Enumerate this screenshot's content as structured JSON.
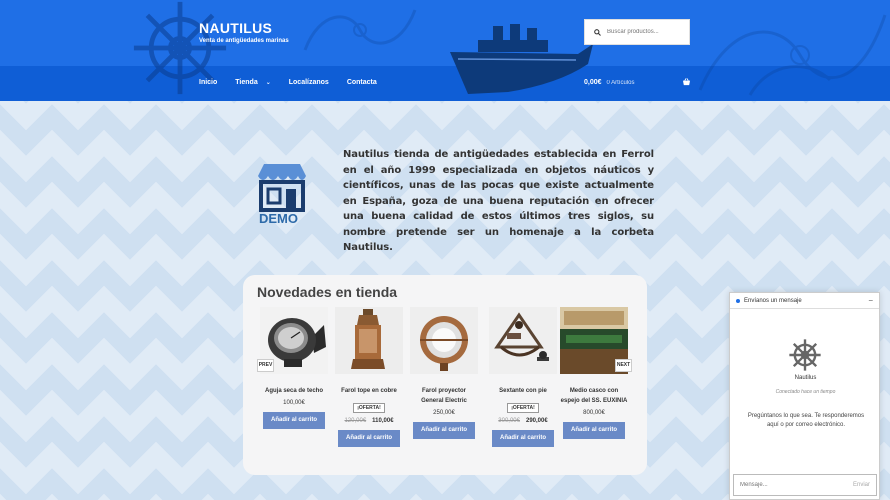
{
  "header": {
    "site_title": "NAUTILUS",
    "site_description": "Venta de antigüedades marinas",
    "search_placeholder": "Buscar productos...",
    "nav": [
      {
        "label": "Inicio"
      },
      {
        "label": "Tienda"
      },
      {
        "label": "Localízanos"
      },
      {
        "label": "Contacta"
      }
    ],
    "cart_total": "0,00€",
    "cart_count": "0 Artículos"
  },
  "intro": {
    "logo_text": "DEMO",
    "text": "Nautilus tienda de antigüedades establecida en Ferrol en el año 1999 especializada en objetos náuticos y científicos, unas de las pocas que existe actualmente en España, goza de una buena reputación en ofrecer una buena calidad de estos últimos tres siglos, su nombre pretende ser un homenaje a la corbeta Nautilus."
  },
  "products_section": {
    "title": "Novedades en tienda",
    "prev_label": "PREV",
    "next_label": "NEXT",
    "products": [
      {
        "name": "Aguja seca de techo",
        "badge": "",
        "old_price": "",
        "price": "100,00€",
        "button": "Añadir al carrito"
      },
      {
        "name": "Farol tope en cobre",
        "badge": "¡OFERTA!",
        "old_price": "120,00€",
        "price": "110,00€",
        "button": "Añadir al carrito"
      },
      {
        "name": "Farol proyector General Electric",
        "badge": "",
        "old_price": "",
        "price": "250,00€",
        "button": "Añadir al carrito"
      },
      {
        "name": "Sextante con pie",
        "badge": "¡OFERTA!",
        "old_price": "300,00€",
        "price": "290,00€",
        "button": "Añadir al carrito"
      },
      {
        "name": "Medio casco con espejo del SS. EUXINIA",
        "badge": "",
        "old_price": "",
        "price": "800,00€",
        "button": "Añadir al carrito"
      }
    ]
  },
  "chat": {
    "header": "Envíanos un mensaje",
    "minimize": "−",
    "name": "Nautilus",
    "status": "Conectado hace un tiempo",
    "message": "Pregúntanos lo que sea. Te responderemos aquí o por correo electrónico.",
    "input_placeholder": "Mensaje...",
    "send_label": "Enviar"
  },
  "colors": {
    "header_blue": "#1f6fe6",
    "nav_blue": "#0f5ed6",
    "button_blue": "#6a8ac7",
    "background": "#cfe0f1"
  }
}
